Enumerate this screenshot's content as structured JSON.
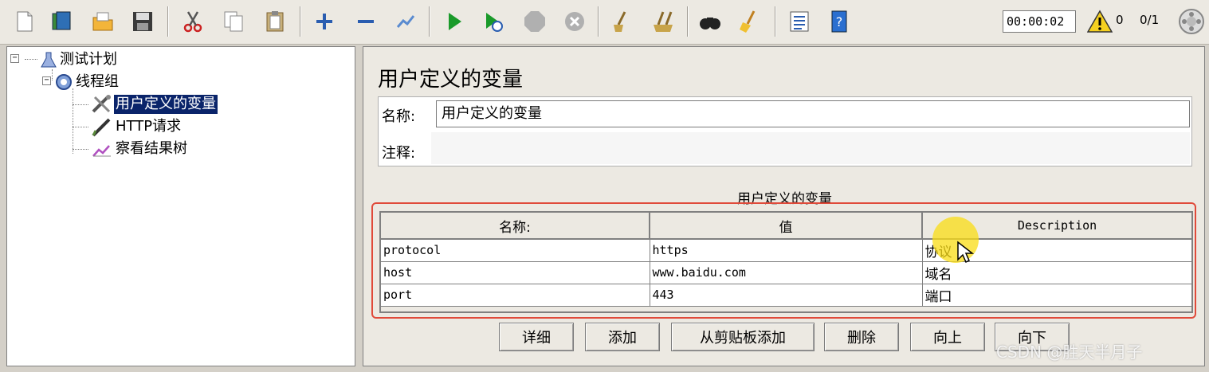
{
  "toolbar": {
    "timer": "00:00:02",
    "warning_count": "0",
    "threads": "0/1",
    "buttons": [
      "new-icon",
      "templates-icon",
      "open-icon",
      "save-icon",
      "cut-icon",
      "copy-icon",
      "paste-icon",
      "expand-icon",
      "collapse-icon",
      "toggle-icon",
      "start-icon",
      "start-no-pause-icon",
      "stop-icon",
      "shutdown-icon",
      "clear-icon",
      "clear-all-icon",
      "search-icon",
      "reset-search-icon",
      "function-helper-icon",
      "help-icon"
    ]
  },
  "tree": {
    "nodes": [
      {
        "label": "测试计划",
        "icon": "test-plan-icon"
      },
      {
        "label": "线程组",
        "icon": "thread-group-icon"
      },
      {
        "label": "用户定义的变量",
        "icon": "config-wrench-icon",
        "selected": true
      },
      {
        "label": "HTTP请求",
        "icon": "sampler-pen-icon"
      },
      {
        "label": "察看结果树",
        "icon": "listener-chart-icon"
      }
    ]
  },
  "panel": {
    "title": "用户定义的变量",
    "name_label": "名称:",
    "name_value": "用户定义的变量",
    "comment_label": "注释:",
    "comment_value": "",
    "table_caption": "用户定义的变量",
    "columns": [
      "名称:",
      "值",
      "Description"
    ],
    "rows": [
      [
        "protocol",
        "https",
        "协议"
      ],
      [
        "host",
        "www.baidu.com",
        "域名"
      ],
      [
        "port",
        "443",
        "端口"
      ]
    ],
    "buttons": [
      "详细",
      "添加",
      "从剪贴板添加",
      "删除",
      "向上",
      "向下"
    ]
  },
  "colors": {
    "selection": "#0a246a",
    "highlight_border": "#e04a3a",
    "cursor_halo": "#fadc14"
  },
  "watermark": "CSDN @胜天半月子"
}
